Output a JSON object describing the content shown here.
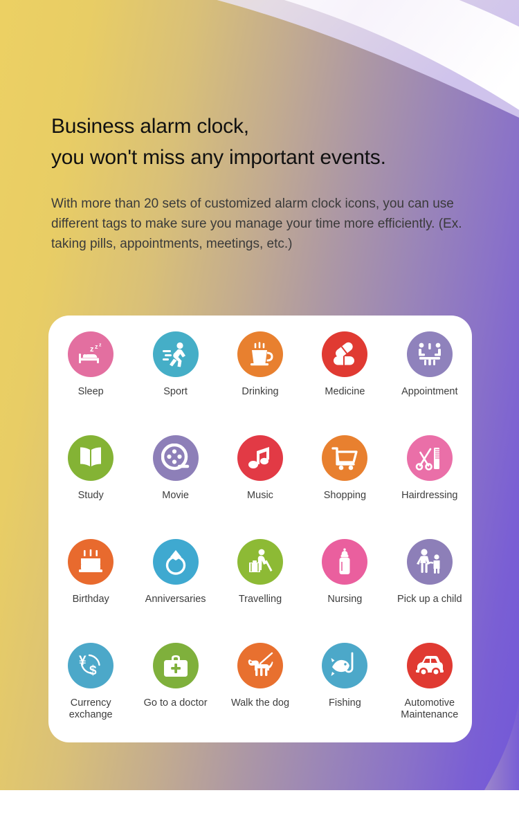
{
  "hero": {
    "headline_line1": "Business alarm clock,",
    "headline_line2": "you won't miss any important events.",
    "paragraph": "With more than 20 sets of customized alarm clock icons, you can use different tags to make sure you manage your time more efficiently. (Ex. taking pills, appointments, meetings, etc.)"
  },
  "colors": {
    "bg_gradient_start": "#ecd063",
    "bg_gradient_end": "#7258d8",
    "card_background": "#ffffff",
    "label_text": "#3d3d3d",
    "headline_text": "#111111"
  },
  "icon_grid": {
    "columns": 5,
    "rows": 4,
    "items": [
      {
        "label": "Sleep",
        "icon": "bed-zzz-icon",
        "color": "#e36fa0"
      },
      {
        "label": "Sport",
        "icon": "running-person-icon",
        "color": "#45aec7"
      },
      {
        "label": "Drinking",
        "icon": "hot-mug-icon",
        "color": "#e8802f"
      },
      {
        "label": "Medicine",
        "icon": "pills-capsule-icon",
        "color": "#e03a32"
      },
      {
        "label": "Appointment",
        "icon": "meeting-table-icon",
        "color": "#8f82bc"
      },
      {
        "label": "Study",
        "icon": "open-book-icon",
        "color": "#84b335"
      },
      {
        "label": "Movie",
        "icon": "film-reel-icon",
        "color": "#8d7fb8"
      },
      {
        "label": "Music",
        "icon": "music-note-icon",
        "color": "#e23a45"
      },
      {
        "label": "Shopping",
        "icon": "shopping-cart-icon",
        "color": "#e8802f"
      },
      {
        "label": "Hairdressing",
        "icon": "scissors-comb-icon",
        "color": "#ea6fa8"
      },
      {
        "label": "Birthday",
        "icon": "birthday-cake-icon",
        "color": "#e86a2e"
      },
      {
        "label": "Anniversaries",
        "icon": "diamond-ring-icon",
        "color": "#3fa9d0"
      },
      {
        "label": "Travelling",
        "icon": "traveller-suitcase-icon",
        "color": "#8dba35"
      },
      {
        "label": "Nursing",
        "icon": "baby-bottle-icon",
        "color": "#ea5f9e"
      },
      {
        "label": "Pick up a child",
        "icon": "parent-child-icon",
        "color": "#8d7fb8"
      },
      {
        "label": "Currency exchange",
        "icon": "currency-exchange-icon",
        "color": "#4ca8c9"
      },
      {
        "label": "Go to a doctor",
        "icon": "medical-bag-icon",
        "color": "#7fb03c"
      },
      {
        "label": "Walk the dog",
        "icon": "dog-leash-icon",
        "color": "#e8702f"
      },
      {
        "label": "Fishing",
        "icon": "fish-hook-icon",
        "color": "#4ca8c9"
      },
      {
        "label": "Automotive Maintenance",
        "icon": "car-icon",
        "color": "#e03a32"
      }
    ]
  }
}
